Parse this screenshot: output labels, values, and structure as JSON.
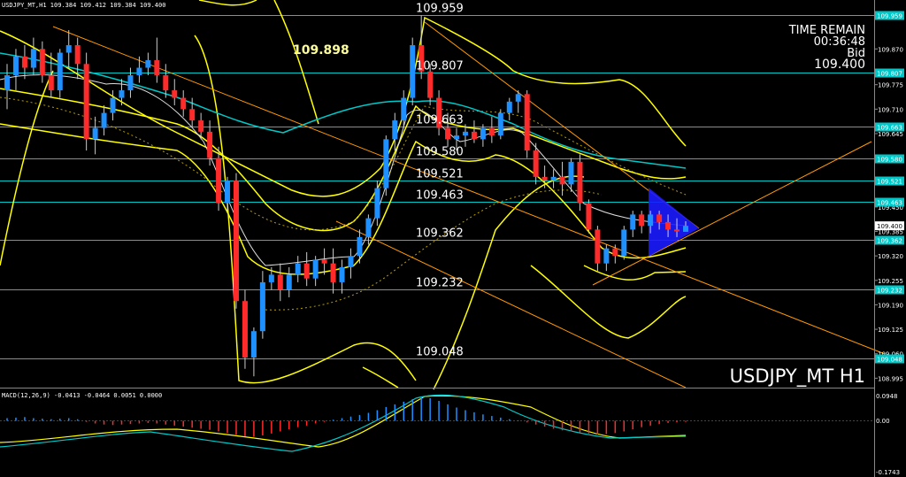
{
  "header": {
    "title": "USDJPY_MT,H1  109.384 109.412 109.384 109.400",
    "time_remain_label": "TIME REMAIN",
    "time_remain_value": "00:36:48",
    "bid_label": "Bid",
    "bid_value": "109.400",
    "watermark": "USDJPY_MT H1",
    "highlight_price": "109.898"
  },
  "price_axis": {
    "ticks": [
      "109.870",
      "109.775",
      "109.710",
      "109.645",
      "109.580",
      "109.515",
      "109.450",
      "109.385",
      "109.320",
      "109.255",
      "109.190",
      "109.125",
      "109.060",
      "108.995"
    ]
  },
  "levels": [
    {
      "label": "109.959",
      "value": 109.959,
      "badge": "109.959"
    },
    {
      "label": "109.807",
      "value": 109.807,
      "badge": "109.807"
    },
    {
      "label": "109.663",
      "value": 109.663,
      "badge": "109.663"
    },
    {
      "label": "109.580",
      "value": 109.58,
      "badge": "109.580"
    },
    {
      "label": "109.521",
      "value": 109.521,
      "badge": "109.521"
    },
    {
      "label": "109.463",
      "value": 109.463,
      "badge": "109.463"
    },
    {
      "label": "109.362",
      "value": 109.362,
      "badge": "109.362"
    },
    {
      "label": "109.232",
      "value": 109.232,
      "badge": "109.232"
    },
    {
      "label": "109.048",
      "value": 109.048,
      "badge": "109.048"
    }
  ],
  "current_price": {
    "value": 109.4,
    "badge": "109.400"
  },
  "macd": {
    "label": "MACD(12,26,9) -0.0413 -0.0464 0.0051 0.0000",
    "ticks": [
      "0.0948",
      "0.00",
      "-0.1743"
    ]
  },
  "colors": {
    "bull": "#1e90ff",
    "bear": "#ff2a2a",
    "level": "#00c8c8",
    "band": "#ffff00",
    "trend": "#ff9900",
    "ma": "#00c8c8",
    "highlight": "#1a1aff"
  },
  "chart_data": {
    "type": "candlestick",
    "symbol": "USDJPY_MT",
    "timeframe": "H1",
    "ylim": [
      108.97,
      110.0
    ],
    "candles": [
      {
        "o": 109.76,
        "h": 109.83,
        "l": 109.71,
        "c": 109.8
      },
      {
        "o": 109.8,
        "h": 109.87,
        "l": 109.76,
        "c": 109.85
      },
      {
        "o": 109.85,
        "h": 109.88,
        "l": 109.79,
        "c": 109.82
      },
      {
        "o": 109.82,
        "h": 109.9,
        "l": 109.8,
        "c": 109.87
      },
      {
        "o": 109.87,
        "h": 109.89,
        "l": 109.78,
        "c": 109.8
      },
      {
        "o": 109.8,
        "h": 109.86,
        "l": 109.74,
        "c": 109.76
      },
      {
        "o": 109.76,
        "h": 109.87,
        "l": 109.74,
        "c": 109.86
      },
      {
        "o": 109.86,
        "h": 109.92,
        "l": 109.82,
        "c": 109.88
      },
      {
        "o": 109.88,
        "h": 109.9,
        "l": 109.79,
        "c": 109.83
      },
      {
        "o": 109.83,
        "h": 109.86,
        "l": 109.6,
        "c": 109.63
      },
      {
        "o": 109.63,
        "h": 109.69,
        "l": 109.59,
        "c": 109.66
      },
      {
        "o": 109.66,
        "h": 109.72,
        "l": 109.64,
        "c": 109.7
      },
      {
        "o": 109.7,
        "h": 109.76,
        "l": 109.68,
        "c": 109.74
      },
      {
        "o": 109.74,
        "h": 109.79,
        "l": 109.72,
        "c": 109.76
      },
      {
        "o": 109.76,
        "h": 109.82,
        "l": 109.74,
        "c": 109.8
      },
      {
        "o": 109.8,
        "h": 109.85,
        "l": 109.78,
        "c": 109.82
      },
      {
        "o": 109.82,
        "h": 109.86,
        "l": 109.8,
        "c": 109.84
      },
      {
        "o": 109.84,
        "h": 109.9,
        "l": 109.78,
        "c": 109.8
      },
      {
        "o": 109.8,
        "h": 109.83,
        "l": 109.74,
        "c": 109.76
      },
      {
        "o": 109.76,
        "h": 109.79,
        "l": 109.72,
        "c": 109.74
      },
      {
        "o": 109.74,
        "h": 109.76,
        "l": 109.69,
        "c": 109.71
      },
      {
        "o": 109.71,
        "h": 109.74,
        "l": 109.66,
        "c": 109.68
      },
      {
        "o": 109.68,
        "h": 109.7,
        "l": 109.63,
        "c": 109.65
      },
      {
        "o": 109.65,
        "h": 109.68,
        "l": 109.56,
        "c": 109.58
      },
      {
        "o": 109.58,
        "h": 109.61,
        "l": 109.44,
        "c": 109.46
      },
      {
        "o": 109.46,
        "h": 109.53,
        "l": 109.44,
        "c": 109.52
      },
      {
        "o": 109.52,
        "h": 109.54,
        "l": 109.18,
        "c": 109.2
      },
      {
        "o": 109.2,
        "h": 109.23,
        "l": 109.02,
        "c": 109.05
      },
      {
        "o": 109.05,
        "h": 109.13,
        "l": 109.0,
        "c": 109.12
      },
      {
        "o": 109.12,
        "h": 109.28,
        "l": 109.1,
        "c": 109.25
      },
      {
        "o": 109.25,
        "h": 109.29,
        "l": 109.23,
        "c": 109.27
      },
      {
        "o": 109.27,
        "h": 109.3,
        "l": 109.2,
        "c": 109.23
      },
      {
        "o": 109.23,
        "h": 109.29,
        "l": 109.21,
        "c": 109.27
      },
      {
        "o": 109.27,
        "h": 109.32,
        "l": 109.25,
        "c": 109.3
      },
      {
        "o": 109.3,
        "h": 109.33,
        "l": 109.24,
        "c": 109.26
      },
      {
        "o": 109.26,
        "h": 109.32,
        "l": 109.24,
        "c": 109.31
      },
      {
        "o": 109.31,
        "h": 109.34,
        "l": 109.27,
        "c": 109.3
      },
      {
        "o": 109.3,
        "h": 109.34,
        "l": 109.22,
        "c": 109.25
      },
      {
        "o": 109.25,
        "h": 109.31,
        "l": 109.22,
        "c": 109.29
      },
      {
        "o": 109.29,
        "h": 109.34,
        "l": 109.26,
        "c": 109.32
      },
      {
        "o": 109.32,
        "h": 109.39,
        "l": 109.3,
        "c": 109.37
      },
      {
        "o": 109.37,
        "h": 109.43,
        "l": 109.35,
        "c": 109.42
      },
      {
        "o": 109.42,
        "h": 109.52,
        "l": 109.4,
        "c": 109.5
      },
      {
        "o": 109.5,
        "h": 109.64,
        "l": 109.48,
        "c": 109.63
      },
      {
        "o": 109.63,
        "h": 109.7,
        "l": 109.6,
        "c": 109.68
      },
      {
        "o": 109.68,
        "h": 109.76,
        "l": 109.66,
        "c": 109.74
      },
      {
        "o": 109.74,
        "h": 109.9,
        "l": 109.72,
        "c": 109.88
      },
      {
        "o": 109.88,
        "h": 109.959,
        "l": 109.79,
        "c": 109.81
      },
      {
        "o": 109.81,
        "h": 109.83,
        "l": 109.72,
        "c": 109.74
      },
      {
        "o": 109.74,
        "h": 109.76,
        "l": 109.64,
        "c": 109.66
      },
      {
        "o": 109.66,
        "h": 109.7,
        "l": 109.61,
        "c": 109.63
      },
      {
        "o": 109.63,
        "h": 109.66,
        "l": 109.6,
        "c": 109.64
      },
      {
        "o": 109.64,
        "h": 109.67,
        "l": 109.61,
        "c": 109.65
      },
      {
        "o": 109.65,
        "h": 109.68,
        "l": 109.62,
        "c": 109.63
      },
      {
        "o": 109.63,
        "h": 109.67,
        "l": 109.61,
        "c": 109.66
      },
      {
        "o": 109.66,
        "h": 109.69,
        "l": 109.62,
        "c": 109.64
      },
      {
        "o": 109.64,
        "h": 109.71,
        "l": 109.63,
        "c": 109.7
      },
      {
        "o": 109.7,
        "h": 109.74,
        "l": 109.68,
        "c": 109.73
      },
      {
        "o": 109.73,
        "h": 109.76,
        "l": 109.7,
        "c": 109.75
      },
      {
        "o": 109.75,
        "h": 109.76,
        "l": 109.58,
        "c": 109.6
      },
      {
        "o": 109.6,
        "h": 109.62,
        "l": 109.51,
        "c": 109.53
      },
      {
        "o": 109.53,
        "h": 109.56,
        "l": 109.5,
        "c": 109.52
      },
      {
        "o": 109.52,
        "h": 109.55,
        "l": 109.5,
        "c": 109.53
      },
      {
        "o": 109.53,
        "h": 109.57,
        "l": 109.48,
        "c": 109.51
      },
      {
        "o": 109.51,
        "h": 109.58,
        "l": 109.49,
        "c": 109.57
      },
      {
        "o": 109.57,
        "h": 109.59,
        "l": 109.44,
        "c": 109.46
      },
      {
        "o": 109.46,
        "h": 109.47,
        "l": 109.38,
        "c": 109.39
      },
      {
        "o": 109.39,
        "h": 109.4,
        "l": 109.28,
        "c": 109.3
      },
      {
        "o": 109.3,
        "h": 109.35,
        "l": 109.28,
        "c": 109.34
      },
      {
        "o": 109.34,
        "h": 109.35,
        "l": 109.3,
        "c": 109.32
      },
      {
        "o": 109.32,
        "h": 109.4,
        "l": 109.31,
        "c": 109.39
      },
      {
        "o": 109.39,
        "h": 109.44,
        "l": 109.37,
        "c": 109.43
      },
      {
        "o": 109.43,
        "h": 109.44,
        "l": 109.38,
        "c": 109.4
      },
      {
        "o": 109.4,
        "h": 109.44,
        "l": 109.38,
        "c": 109.43
      },
      {
        "o": 109.43,
        "h": 109.44,
        "l": 109.39,
        "c": 109.41
      },
      {
        "o": 109.41,
        "h": 109.43,
        "l": 109.37,
        "c": 109.39
      },
      {
        "o": 109.39,
        "h": 109.42,
        "l": 109.37,
        "c": 109.385
      },
      {
        "o": 109.384,
        "h": 109.412,
        "l": 109.384,
        "c": 109.4
      }
    ],
    "macd_hist": [
      0.01,
      0.012,
      0.014,
      0.01,
      0.008,
      0.006,
      0.008,
      0.01,
      0.006,
      -0.004,
      -0.01,
      -0.014,
      -0.016,
      -0.014,
      -0.012,
      -0.01,
      -0.008,
      -0.01,
      -0.014,
      -0.018,
      -0.022,
      -0.026,
      -0.03,
      -0.034,
      -0.04,
      -0.046,
      -0.052,
      -0.058,
      -0.06,
      -0.055,
      -0.048,
      -0.04,
      -0.032,
      -0.024,
      -0.018,
      -0.01,
      -0.004,
      0.004,
      0.01,
      0.016,
      0.022,
      0.03,
      0.04,
      0.052,
      0.062,
      0.072,
      0.082,
      0.09,
      0.085,
      0.075,
      0.062,
      0.05,
      0.04,
      0.032,
      0.024,
      0.018,
      0.012,
      0.006,
      0.002,
      -0.006,
      -0.014,
      -0.022,
      -0.03,
      -0.036,
      -0.04,
      -0.044,
      -0.048,
      -0.052,
      -0.05,
      -0.046,
      -0.04,
      -0.032,
      -0.024,
      -0.018,
      -0.012,
      -0.008,
      -0.006,
      -0.004
    ]
  }
}
